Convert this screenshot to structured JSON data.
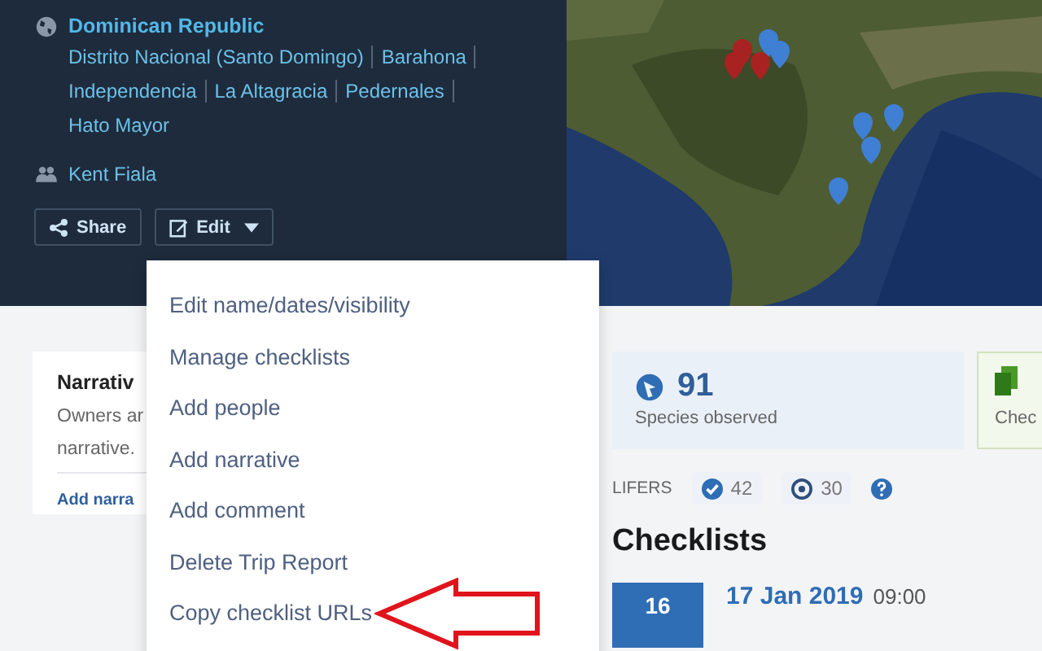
{
  "location": {
    "country": "Dominican Republic",
    "regions": [
      "Distrito Nacional (Santo Domingo)",
      "Barahona",
      "Independencia",
      "La Altagracia",
      "Pedernales",
      "Hato Mayor"
    ]
  },
  "people": [
    "Kent Fiala"
  ],
  "buttons": [
    {
      "label": "Share",
      "kind": "share"
    },
    {
      "label": "Edit",
      "kind": "edit"
    }
  ],
  "menu": {
    "items": [
      {
        "label": "Edit name/dates/visibility",
        "marked": false
      },
      {
        "label": "Manage checklists",
        "marked": false
      },
      {
        "label": "Add people",
        "marked": false
      },
      {
        "label": "Add narrative",
        "marked": false
      },
      {
        "label": "Add comment",
        "marked": false
      },
      {
        "label": "Delete Trip Report",
        "marked": false
      },
      {
        "label": "Copy checklist URLs",
        "marked": true
      }
    ]
  },
  "narrative_card": {
    "title": "Narrativ",
    "text_lines": [
      "Owners ar",
      "narrative."
    ],
    "link": "Add narra"
  },
  "stats": [
    {
      "kind": "species",
      "value": "91",
      "label": "Species observed"
    },
    {
      "kind": "checklists",
      "label": "Chec"
    }
  ],
  "lifers": {
    "label": "LIFERS",
    "counts": [
      {
        "kind": "seen",
        "value": "42"
      },
      {
        "kind": "heard",
        "value": "30"
      }
    ]
  },
  "checklists": {
    "title": "Checklists",
    "items": [
      {
        "day": "16",
        "date": "17 Jan 2019",
        "time": "09:00"
      }
    ]
  }
}
